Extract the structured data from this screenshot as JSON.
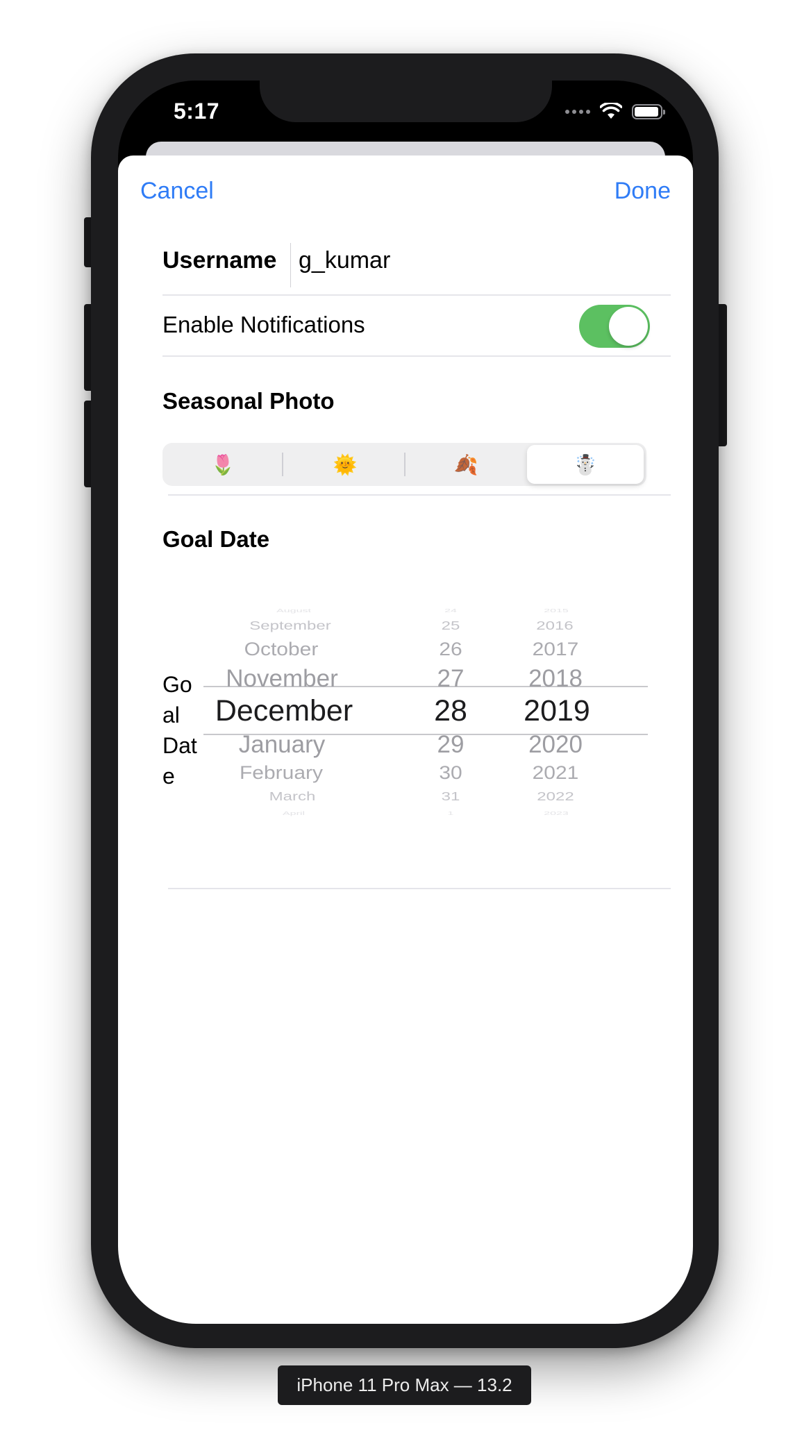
{
  "status_bar": {
    "time": "5:17"
  },
  "nav": {
    "cancel": "Cancel",
    "done": "Done"
  },
  "form": {
    "username_label": "Username",
    "username_value": "g_kumar",
    "notifications_label": "Enable Notifications",
    "notifications_on": true,
    "seasonal_label": "Seasonal Photo",
    "seasons": [
      {
        "icon": "tulip-icon",
        "glyph": "🌷"
      },
      {
        "icon": "sun-face-icon",
        "glyph": "🌞"
      },
      {
        "icon": "fallen-leaf-icon",
        "glyph": "🍂"
      },
      {
        "icon": "snowman-icon",
        "glyph": "☃️"
      }
    ],
    "season_selected": 3,
    "goal_label": "Goal Date",
    "goal_side_label": "Goal Date"
  },
  "picker": {
    "months": [
      "August",
      "September",
      "October",
      "November",
      "December",
      "January",
      "February",
      "March",
      "April"
    ],
    "days": [
      "24",
      "25",
      "26",
      "27",
      "28",
      "29",
      "30",
      "31",
      "1"
    ],
    "years": [
      "2015",
      "2016",
      "2017",
      "2018",
      "2019",
      "2020",
      "2021",
      "2022",
      "2023"
    ],
    "selected_index": 4,
    "selected_month": "December",
    "selected_day": "28",
    "selected_year": "2019"
  },
  "device_label": "iPhone 11 Pro Max — 13.2"
}
